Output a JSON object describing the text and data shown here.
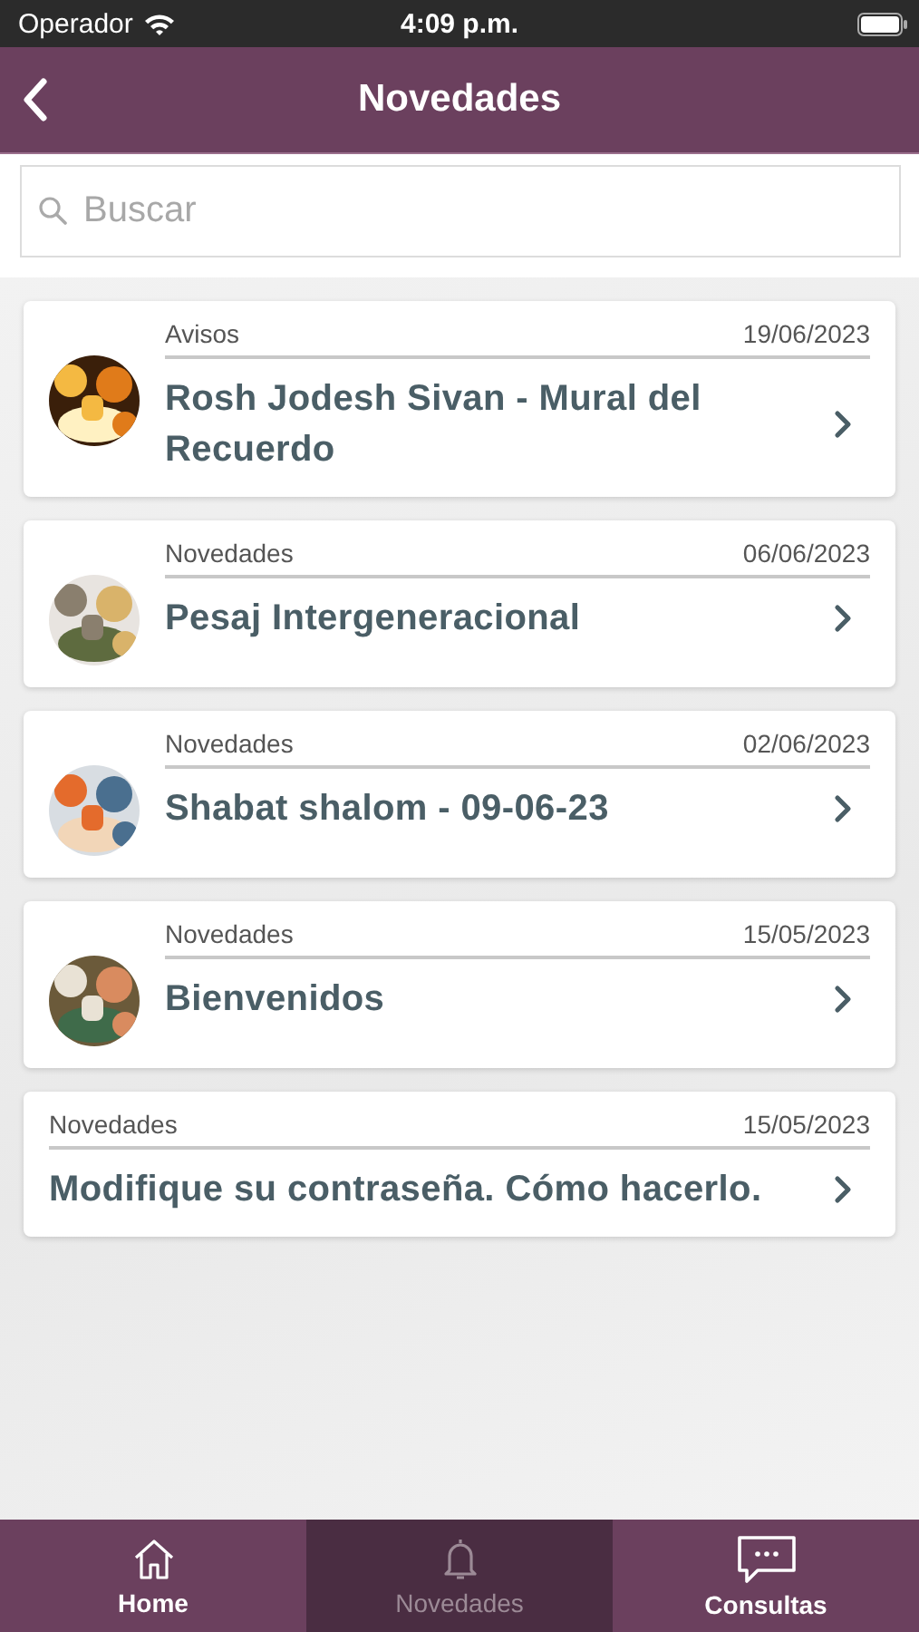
{
  "status_bar": {
    "carrier": "Operador",
    "time": "4:09 p.m."
  },
  "header": {
    "title": "Novedades"
  },
  "search": {
    "placeholder": "Buscar"
  },
  "items": [
    {
      "category": "Avisos",
      "date": "19/06/2023",
      "title": "Rosh Jodesh Sivan - Mural del Recuerdo"
    },
    {
      "category": "Novedades",
      "date": "06/06/2023",
      "title": "Pesaj Intergeneracional"
    },
    {
      "category": "Novedades",
      "date": "02/06/2023",
      "title": "Shabat shalom - 09-06-23"
    },
    {
      "category": "Novedades",
      "date": "15/05/2023",
      "title": "Bienvenidos"
    },
    {
      "category": "Novedades",
      "date": "15/05/2023",
      "title": "Modifique su contraseña. Cómo hacerlo."
    }
  ],
  "tabs": [
    {
      "label": "Home",
      "selected": false
    },
    {
      "label": "Novedades",
      "selected": true
    },
    {
      "label": "Consultas",
      "selected": false
    }
  ]
}
